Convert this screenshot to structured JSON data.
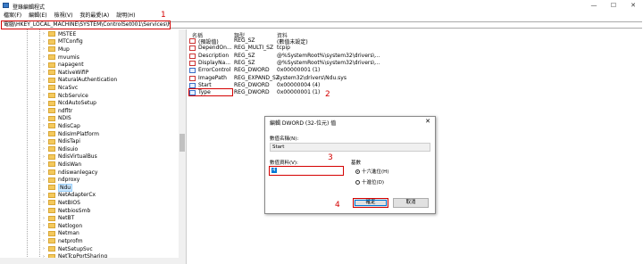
{
  "window": {
    "title": "登錄編輯程式",
    "minimize": "—",
    "maximize": "☐",
    "close": "✕"
  },
  "menu": [
    "檔案(F)",
    "編輯(E)",
    "檢視(V)",
    "我的最愛(A)",
    "說明(H)"
  ],
  "address": "電腦\\HKEY_LOCAL_MACHINE\\SYSTEM\\ControlSet001\\Services\\Ndu",
  "annotations": [
    "1",
    "2",
    "3",
    "4"
  ],
  "tree": [
    {
      "label": "MSTEE"
    },
    {
      "label": "MTConfig"
    },
    {
      "label": "Mup"
    },
    {
      "label": "mvumis"
    },
    {
      "label": "napagent"
    },
    {
      "label": "NativeWifiP"
    },
    {
      "label": "NaturalAuthentication"
    },
    {
      "label": "NcaSvc"
    },
    {
      "label": "NcbService"
    },
    {
      "label": "NcdAutoSetup"
    },
    {
      "label": "ndfltr"
    },
    {
      "label": "NDIS"
    },
    {
      "label": "NdisCap"
    },
    {
      "label": "NdisImPlatform"
    },
    {
      "label": "NdisTapi"
    },
    {
      "label": "Ndisuio"
    },
    {
      "label": "NdisVirtualBus"
    },
    {
      "label": "NdisWan"
    },
    {
      "label": "ndiswanlegacy"
    },
    {
      "label": "ndproxy"
    },
    {
      "label": "Ndu",
      "selected": true
    },
    {
      "label": "NetAdapterCx"
    },
    {
      "label": "NetBIOS"
    },
    {
      "label": "NetbiosSmb"
    },
    {
      "label": "NetBT"
    },
    {
      "label": "Netlogon"
    },
    {
      "label": "Netman"
    },
    {
      "label": "netprofm"
    },
    {
      "label": "NetSetupSvc"
    },
    {
      "label": "NetTcpPortSharing"
    }
  ],
  "values_header": {
    "name": "名稱",
    "type": "類型",
    "data": "資料"
  },
  "values": [
    {
      "icon": "ab",
      "name": "(預設值)",
      "type": "REG_SZ",
      "data": "(數值未設定)"
    },
    {
      "icon": "ab",
      "name": "DependOn...",
      "type": "REG_MULTI_SZ",
      "data": "tcpip"
    },
    {
      "icon": "ab",
      "name": "Description",
      "type": "REG_SZ",
      "data": "@%SystemRoot%\\system32\\drivers\\..."
    },
    {
      "icon": "ab",
      "name": "DisplayNa...",
      "type": "REG_SZ",
      "data": "@%SystemRoot%\\system32\\drivers\\..."
    },
    {
      "icon": "bin",
      "name": "ErrorControl",
      "type": "REG_DWORD",
      "data": "0x00000001 (1)"
    },
    {
      "icon": "ab",
      "name": "ImagePath",
      "type": "REG_EXPAND_SZ",
      "data": "system32\\drivers\\Ndu.sys"
    },
    {
      "icon": "bin",
      "name": "Start",
      "type": "REG_DWORD",
      "data": "0x00000004 (4)"
    },
    {
      "icon": "bin",
      "name": "Type",
      "type": "REG_DWORD",
      "data": "0x00000001 (1)"
    }
  ],
  "dialog": {
    "title": "編輯 DWORD (32-位元) 值",
    "close": "✕",
    "name_label": "數值名稱(N):",
    "name_value": "Start",
    "data_label": "數值資料(V):",
    "data_value": "4",
    "base_label": "基數",
    "hex_label": "十六進位(H)",
    "dec_label": "十進位(D)",
    "ok": "確定",
    "cancel": "取消"
  }
}
